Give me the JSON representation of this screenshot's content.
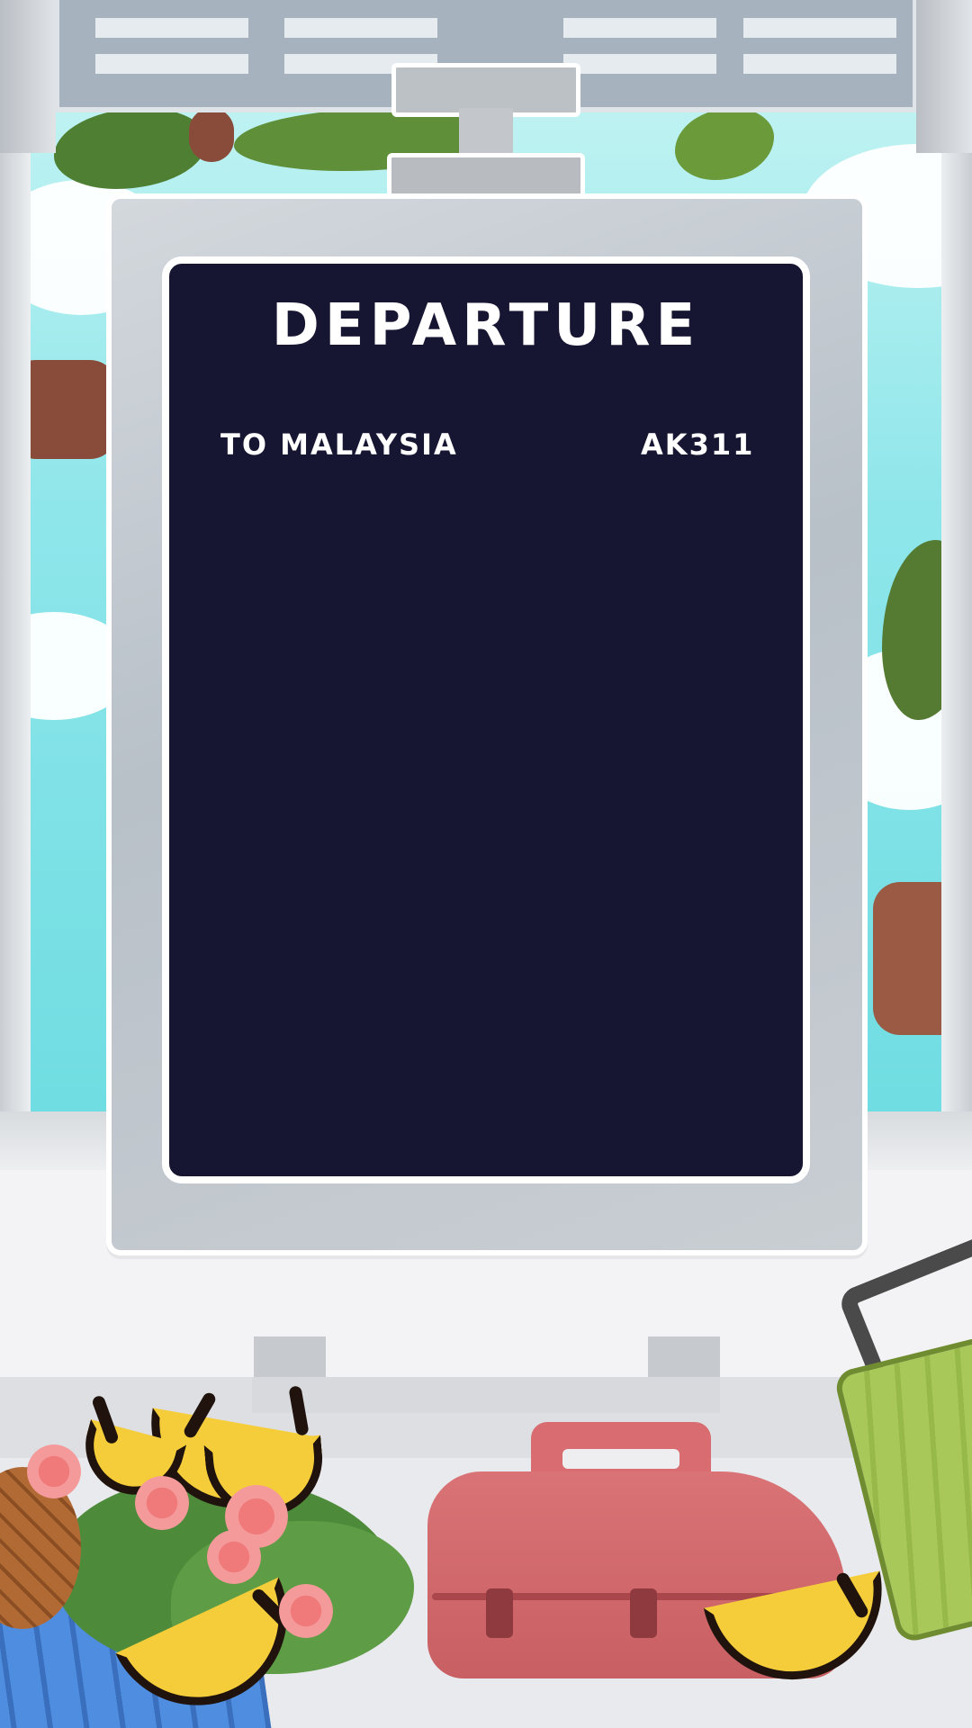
{
  "board": {
    "title": "DEPARTURE",
    "destination": "TO MALAYSIA",
    "flight_code": "AK311"
  },
  "colors": {
    "board_screen": "#161532",
    "board_frame": "#c4cad0",
    "board_text": "#ffffff",
    "sky": "#8ee6ea",
    "bag": "#d86c70",
    "suitcase": "#a9c85a",
    "banana": "#f5cd3a",
    "basket": "#4f8de0"
  },
  "icons": {
    "bag": "travel-bag-icon",
    "suitcase": "suitcase-icon",
    "banana": "banana-icon",
    "pineapple": "pineapple-icon",
    "flower": "hibiscus-flower-icon"
  }
}
